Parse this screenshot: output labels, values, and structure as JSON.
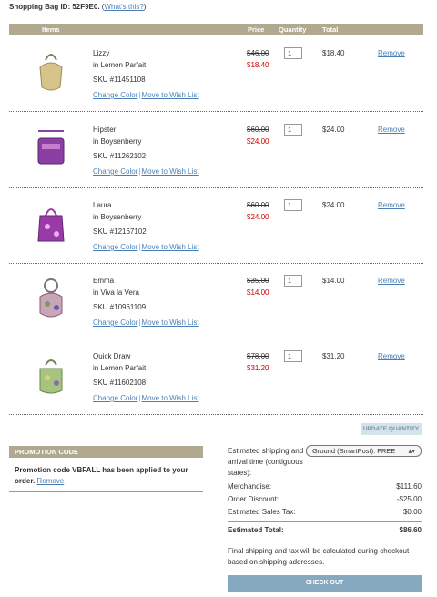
{
  "header": {
    "bag_label": "Shopping Bag ID: 52F9E0.",
    "whats_this": "What's this?"
  },
  "table_header": {
    "items": "Items",
    "price": "Price",
    "quantity": "Quantity",
    "total": "Total"
  },
  "items": [
    {
      "name": "Lizzy",
      "color": "in Lemon Parfait",
      "sku": "SKU #11451108",
      "orig_price": "$46.00",
      "sale_price": "$18.40",
      "qty": "1",
      "total": "$18.40",
      "remove": "Remove",
      "change_color": "Change Color",
      "move_wish": "Move to Wish List",
      "swatch": "#d6c48a"
    },
    {
      "name": "Hipster",
      "color": "in Boysenberry",
      "sku": "SKU #11262102",
      "orig_price": "$60.00",
      "sale_price": "$24.00",
      "qty": "1",
      "total": "$24.00",
      "remove": "Remove",
      "change_color": "Change Color",
      "move_wish": "Move to Wish List",
      "swatch": "#8a3fa3"
    },
    {
      "name": "Laura",
      "color": "in Boysenberry",
      "sku": "SKU #12167102",
      "orig_price": "$60.00",
      "sale_price": "$24.00",
      "qty": "1",
      "total": "$24.00",
      "remove": "Remove",
      "change_color": "Change Color",
      "move_wish": "Move to Wish List",
      "swatch": "#9a3aa8"
    },
    {
      "name": "Emma",
      "color": "in Viva la Vera",
      "sku": "SKU #10961109",
      "orig_price": "$35.00",
      "sale_price": "$14.00",
      "qty": "1",
      "total": "$14.00",
      "remove": "Remove",
      "change_color": "Change Color",
      "move_wish": "Move to Wish List",
      "swatch": "#c9a5b8"
    },
    {
      "name": "Quick Draw",
      "color": "in Lemon Parfait",
      "sku": "SKU #11602108",
      "orig_price": "$78.00",
      "sale_price": "$31.20",
      "qty": "1",
      "total": "$31.20",
      "remove": "Remove",
      "change_color": "Change Color",
      "move_wish": "Move to Wish List",
      "swatch": "#a7c47e"
    }
  ],
  "separator": "|",
  "update_quantity": "UPDATE QUANTITY",
  "promo": {
    "heading": "PROMOTION CODE",
    "message": "Promotion code VBFALL has been applied to your order.",
    "remove": "Remove"
  },
  "summary": {
    "shipping_label": "Estimated shipping and arrival time (contiguous states):",
    "shipping_option": "Ground (SmartPost):  FREE",
    "merchandise_label": "Merchandise:",
    "merchandise_value": "$111.60",
    "discount_label": "Order Discount:",
    "discount_value": "-$25.00",
    "tax_label": "Estimated Sales Tax:",
    "tax_value": "$0.00",
    "total_label": "Estimated Total:",
    "total_value": "$86.60",
    "note": "Final shipping and tax will be calculated during checkout based on shipping addresses."
  },
  "checkout": "CHECK OUT"
}
